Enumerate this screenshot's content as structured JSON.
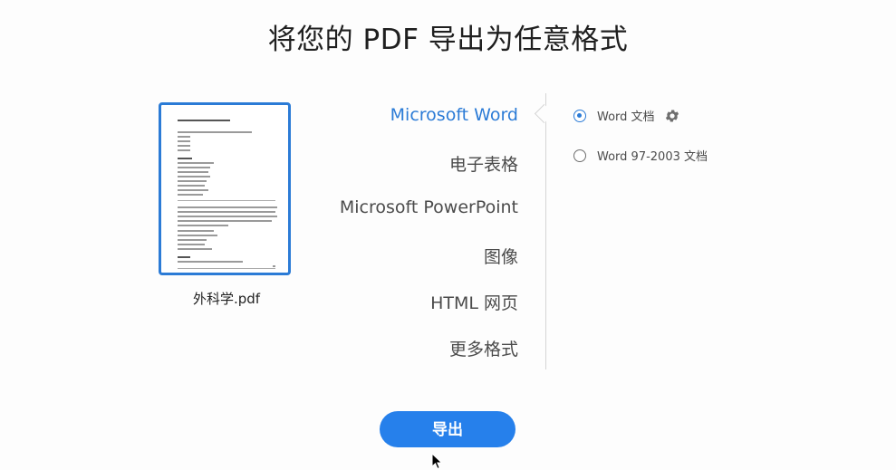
{
  "page": {
    "title": "将您的 PDF 导出为任意格式"
  },
  "file": {
    "name": "外科学.pdf"
  },
  "formats": [
    {
      "label": "Microsoft Word",
      "active": true
    },
    {
      "label": "电子表格",
      "active": false
    },
    {
      "label": "Microsoft PowerPoint",
      "active": false
    },
    {
      "label": "图像",
      "active": false
    },
    {
      "label": "HTML 网页",
      "active": false
    },
    {
      "label": "更多格式",
      "active": false
    }
  ],
  "options": [
    {
      "label": "Word 文档",
      "checked": true,
      "has_settings": true,
      "settings_icon": "gear-icon"
    },
    {
      "label": "Word 97-2003 文档",
      "checked": false,
      "has_settings": false
    }
  ],
  "actions": {
    "export_label": "导出"
  },
  "colors": {
    "accent": "#2b7bd6",
    "button": "#2680eb",
    "text": "#4b4b4b"
  }
}
